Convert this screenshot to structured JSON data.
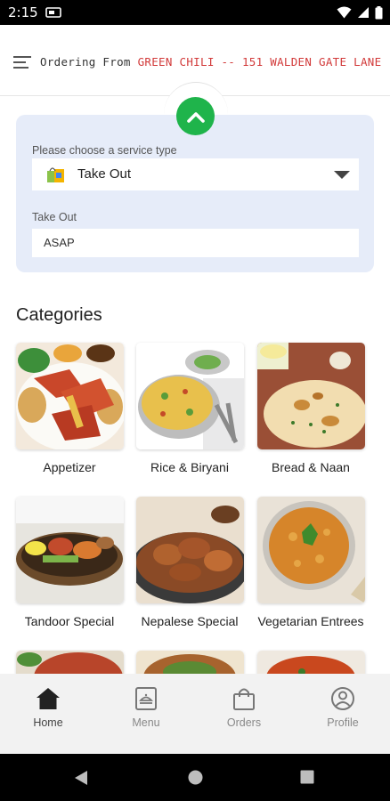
{
  "status_bar": {
    "time": "2:15"
  },
  "header": {
    "ordering_prefix": "Ordering From ",
    "store_name": "GREEN CHILI -- 151 WALDEN GATE LANE"
  },
  "service": {
    "type_label": "Please choose a service type",
    "selected_type": "Take Out",
    "time_label": "Take Out",
    "time_value": "ASAP"
  },
  "categories": {
    "heading": "Categories",
    "items": [
      {
        "name": "Appetizer"
      },
      {
        "name": "Rice & Biryani"
      },
      {
        "name": "Bread & Naan"
      },
      {
        "name": "Tandoor Special"
      },
      {
        "name": "Nepalese Special"
      },
      {
        "name": "Vegetarian Entrees"
      }
    ]
  },
  "bottom_nav": {
    "items": [
      {
        "label": "Home",
        "icon": "home-icon",
        "active": true
      },
      {
        "label": "Menu",
        "icon": "menu-book-icon",
        "active": false
      },
      {
        "label": "Orders",
        "icon": "shopping-bag-icon",
        "active": false
      },
      {
        "label": "Profile",
        "icon": "profile-icon",
        "active": false
      }
    ]
  },
  "colors": {
    "accent_green": "#1fb44b",
    "store_red": "#d23a3a",
    "panel_bg": "#e6ecf9"
  }
}
